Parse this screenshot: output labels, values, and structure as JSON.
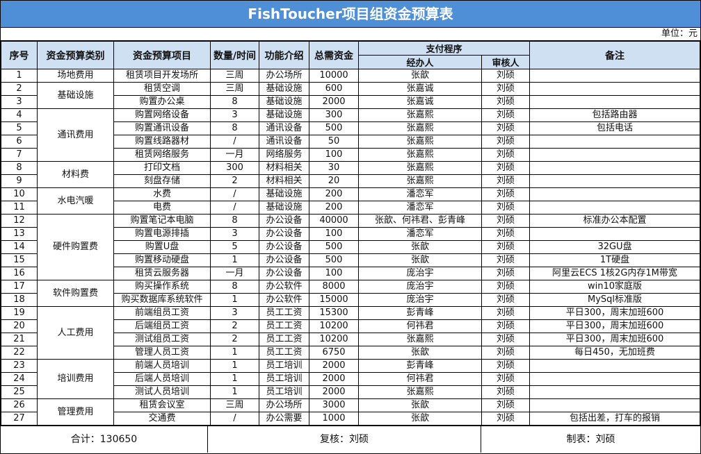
{
  "title": "FishToucher项目组资金预算表",
  "unit": "单位：元",
  "headers": {
    "seq": "序号",
    "category": "资金预算类别",
    "item": "资金预算项目",
    "qty": "数量/时间",
    "func": "功能介绍",
    "total": "总需资金",
    "payment": "支付程序",
    "handler": "经办人",
    "reviewer": "审核人",
    "remark": "备注"
  },
  "rows": [
    {
      "seq": "1",
      "item": "租赁项目开发场所",
      "qty": "三周",
      "func": "办公场所",
      "total": "10000",
      "handler": "张歆",
      "reviewer": "刘硕",
      "remark": ""
    },
    {
      "seq": "2",
      "item": "租赁空调",
      "qty": "三周",
      "func": "基础设施",
      "total": "600",
      "handler": "张嘉诚",
      "reviewer": "刘硕",
      "remark": ""
    },
    {
      "seq": "3",
      "item": "购置办公桌",
      "qty": "8",
      "func": "基础设施",
      "total": "2000",
      "handler": "张嘉诚",
      "reviewer": "刘硕",
      "remark": ""
    },
    {
      "seq": "4",
      "item": "购置网络设备",
      "qty": "3",
      "func": "基础设施",
      "total": "300",
      "handler": "张嘉熙",
      "reviewer": "刘硕",
      "remark": "包括路由器"
    },
    {
      "seq": "5",
      "item": "购置通讯设备",
      "qty": "8",
      "func": "通讯设备",
      "total": "500",
      "handler": "张嘉熙",
      "reviewer": "刘硕",
      "remark": "包括电话"
    },
    {
      "seq": "6",
      "item": "购置线路器材",
      "qty": "/",
      "func": "通讯设备",
      "total": "50",
      "handler": "张嘉熙",
      "reviewer": "刘硕",
      "remark": ""
    },
    {
      "seq": "7",
      "item": "租赁网络服务",
      "qty": "一月",
      "func": "网络服务",
      "total": "100",
      "handler": "张嘉熙",
      "reviewer": "刘硕",
      "remark": ""
    },
    {
      "seq": "8",
      "item": "打印文档",
      "qty": "300",
      "func": "材料相关",
      "total": "30",
      "handler": "张嘉熙",
      "reviewer": "刘硕",
      "remark": ""
    },
    {
      "seq": "9",
      "item": "刻盘存储",
      "qty": "2",
      "func": "材料相关",
      "total": "20",
      "handler": "张嘉熙",
      "reviewer": "刘硕",
      "remark": ""
    },
    {
      "seq": "10",
      "item": "水费",
      "qty": "/",
      "func": "基础设施",
      "total": "200",
      "handler": "潘恋军",
      "reviewer": "刘硕",
      "remark": ""
    },
    {
      "seq": "11",
      "item": "电费",
      "qty": "/",
      "func": "基础设施",
      "total": "200",
      "handler": "潘恋军",
      "reviewer": "刘硕",
      "remark": ""
    },
    {
      "seq": "12",
      "item": "购置笔记本电脑",
      "qty": "8",
      "func": "办公设备",
      "total": "40000",
      "handler": "张歆、何祎君、彭青峰",
      "reviewer": "刘硕",
      "remark": "标准办公本配置"
    },
    {
      "seq": "13",
      "item": "购置电源排插",
      "qty": "3",
      "func": "办公设备",
      "total": "100",
      "handler": "潘恋军",
      "reviewer": "刘硕",
      "remark": ""
    },
    {
      "seq": "14",
      "item": "购置U盘",
      "qty": "5",
      "func": "办公设备",
      "total": "500",
      "handler": "张歆",
      "reviewer": "刘硕",
      "remark": "32GU盘"
    },
    {
      "seq": "15",
      "item": "购置移动硬盘",
      "qty": "1",
      "func": "办公设备",
      "total": "500",
      "handler": "张歆",
      "reviewer": "刘硕",
      "remark": "1T硬盘"
    },
    {
      "seq": "16",
      "item": "租赁云服务器",
      "qty": "一月",
      "func": "办公设备",
      "total": "100",
      "handler": "庞治宇",
      "reviewer": "刘硕",
      "remark": "阿里云ECS 1核2G内存1M带宽"
    },
    {
      "seq": "17",
      "item": "购买操作系统",
      "qty": "8",
      "func": "办公软件",
      "total": "8000",
      "handler": "庞治宇",
      "reviewer": "刘硕",
      "remark": "win10家庭版"
    },
    {
      "seq": "18",
      "item": "购买数据库系统软件",
      "qty": "1",
      "func": "办公软件",
      "total": "15000",
      "handler": "庞治宇",
      "reviewer": "刘硕",
      "remark": "MySql标准版"
    },
    {
      "seq": "19",
      "item": "前端组员工资",
      "qty": "3",
      "func": "员工工资",
      "total": "15300",
      "handler": "彭青峰",
      "reviewer": "刘硕",
      "remark": "平日300，周末加班600"
    },
    {
      "seq": "20",
      "item": "后端组员工资",
      "qty": "2",
      "func": "员工工资",
      "total": "10200",
      "handler": "何祎君",
      "reviewer": "刘硕",
      "remark": "平日300，周末加班600"
    },
    {
      "seq": "21",
      "item": "测试组员工资",
      "qty": "2",
      "func": "员工工资",
      "total": "10200",
      "handler": "张嘉熙",
      "reviewer": "刘硕",
      "remark": "平日300，周末加班600"
    },
    {
      "seq": "22",
      "item": "管理人员工资",
      "qty": "1",
      "func": "员工工资",
      "total": "6750",
      "handler": "张歆",
      "reviewer": "刘硕",
      "remark": "每日450，无加班费"
    },
    {
      "seq": "23",
      "item": "前端人员培训",
      "qty": "1",
      "func": "员工培训",
      "total": "2000",
      "handler": "彭青峰",
      "reviewer": "刘硕",
      "remark": ""
    },
    {
      "seq": "24",
      "item": "后端人员培训",
      "qty": "1",
      "func": "员工培训",
      "total": "2000",
      "handler": "何祎君",
      "reviewer": "刘硕",
      "remark": ""
    },
    {
      "seq": "25",
      "item": "测试人员培训",
      "qty": "1",
      "func": "员工培训",
      "total": "2000",
      "handler": "张嘉熙",
      "reviewer": "刘硕",
      "remark": ""
    },
    {
      "seq": "26",
      "item": "租赁会议室",
      "qty": "三周",
      "func": "办公场所",
      "total": "3000",
      "handler": "张歆",
      "reviewer": "刘硕",
      "remark": ""
    },
    {
      "seq": "27",
      "item": "交通费",
      "qty": "/",
      "func": "办公需要",
      "total": "1000",
      "handler": "张歆",
      "reviewer": "刘硕",
      "remark": "包括出差，打车的报销"
    }
  ],
  "categories": [
    {
      "label": "场地费用",
      "span": 1
    },
    {
      "label": "基础设施",
      "span": 2
    },
    {
      "label": "通讯费用",
      "span": 4
    },
    {
      "label": "材料费",
      "span": 2
    },
    {
      "label": "水电汽暖",
      "span": 2
    },
    {
      "label": "硬件购置费",
      "span": 5
    },
    {
      "label": "软件购置费",
      "span": 2
    },
    {
      "label": "人工费用",
      "span": 4
    },
    {
      "label": "培训费用",
      "span": 3
    },
    {
      "label": "管理费用",
      "span": 2
    }
  ],
  "footer": {
    "total": "合计：130650",
    "review": "复核：刘硕",
    "maker": "制表：刘硕"
  },
  "colors": {
    "title_bg": "#4f8fd6",
    "header_bg": "#cfe0f3"
  }
}
